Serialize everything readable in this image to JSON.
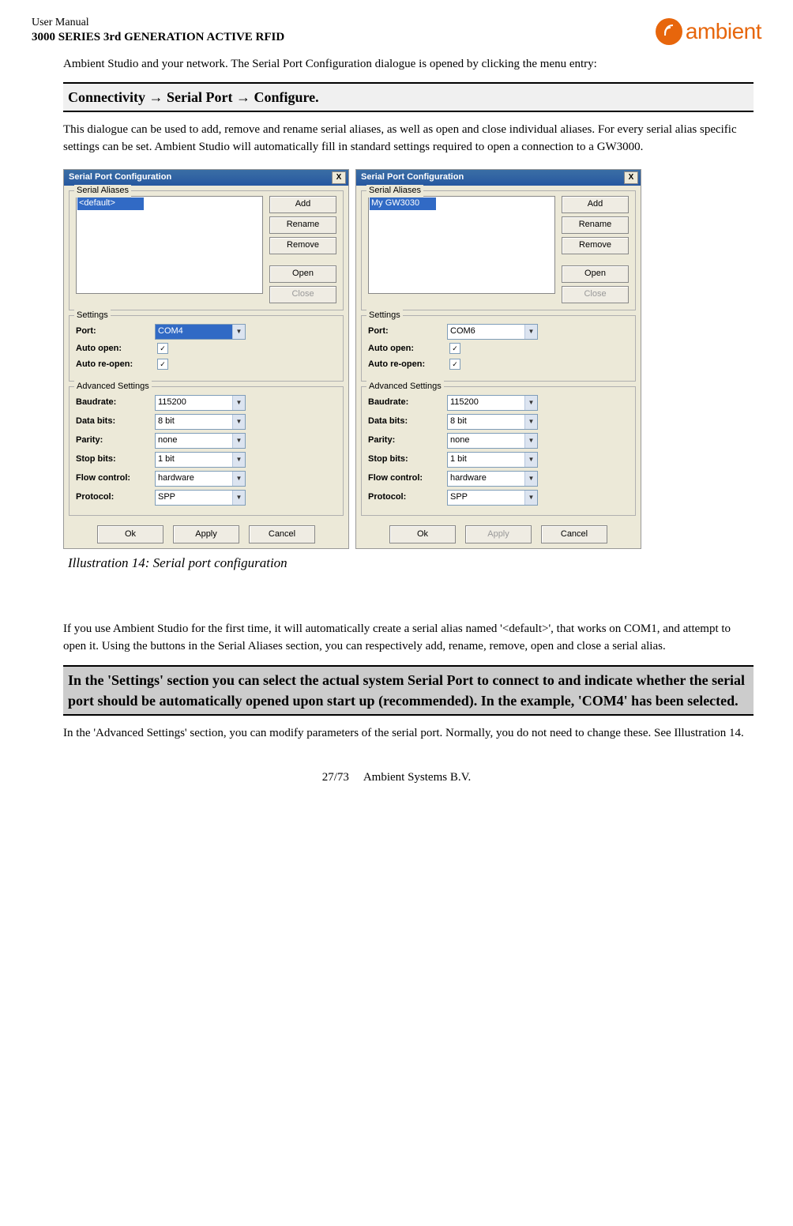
{
  "header": {
    "manual_title": "User Manual",
    "series_title": "3000 SERIES 3rd GENERATION ACTIVE RFID",
    "logo_text": "ambient"
  },
  "para_intro": "Ambient Studio and your network. The Serial Port Configuration dialogue is opened by clicking the menu entry:",
  "banner_connectivity": "Connectivity → Serial Port → Configure.",
  "para_dialogue": "This dialogue can be used to add, remove and rename serial aliases, as well as open and close individual aliases. For every serial alias specific settings can be set. Ambient Studio will automatically fill in standard settings required to open a connection to a GW3000.",
  "caption": "Illustration 14: Serial port configuration",
  "para_firsttime": "If you use Ambient Studio for the first time, it will automatically create a serial alias named '<default>', that works on COM1, and attempt to open it. Using the buttons in the Serial Aliases section, you can respectively add, rename, remove, open and close a serial alias.",
  "banner_settings": "In the 'Settings' section you can select the actual system Serial Port to connect to and indicate whether the serial port should be automatically opened upon start up (recommended). In the example, 'COM4' has been selected.",
  "para_advanced": "In the 'Advanced Settings' section, you can modify parameters of the serial port. Normally, you do not need to change these. See Illustration 14.",
  "footer": {
    "page": "27/73",
    "company": "Ambient Systems B.V."
  },
  "dialog": {
    "title": "Serial Port Configuration",
    "close_label": "X",
    "grp_aliases": "Serial Aliases",
    "grp_settings": "Settings",
    "grp_advanced": "Advanced Settings",
    "btn_add": "Add",
    "btn_rename": "Rename",
    "btn_remove": "Remove",
    "btn_open": "Open",
    "btn_close": "Close",
    "lbl_port": "Port:",
    "lbl_auto_open": "Auto open:",
    "lbl_auto_reopen": "Auto re-open:",
    "lbl_baud": "Baudrate:",
    "lbl_databits": "Data bits:",
    "lbl_parity": "Parity:",
    "lbl_stopbits": "Stop bits:",
    "lbl_flow": "Flow control:",
    "lbl_protocol": "Protocol:",
    "btn_ok": "Ok",
    "btn_apply": "Apply",
    "btn_cancel": "Cancel",
    "chk_on": "✓",
    "left": {
      "alias_item": "<default>",
      "port": "COM4"
    },
    "right": {
      "alias_item": "My GW3030",
      "port": "COM6"
    },
    "baud": "115200",
    "databits": "8 bit",
    "parity": "none",
    "stopbits": "1 bit",
    "flow": "hardware",
    "protocol": "SPP"
  }
}
